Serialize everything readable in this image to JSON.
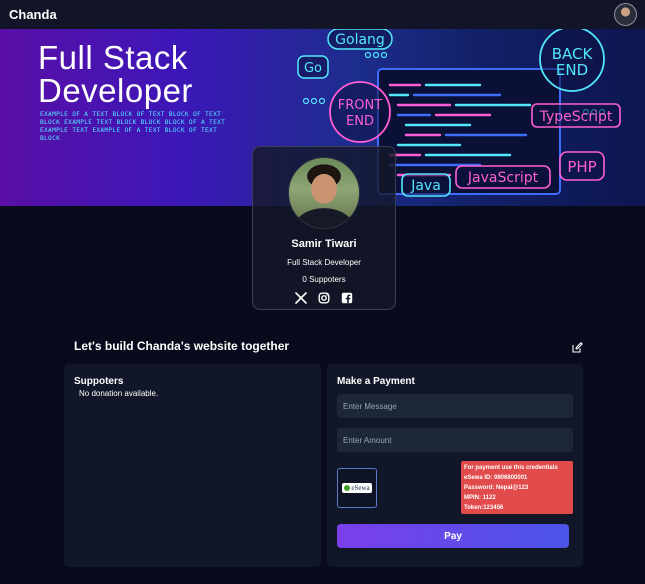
{
  "nav": {
    "brand": "Chanda"
  },
  "banner": {
    "title": "Full Stack\nDeveloper",
    "blurb": "EXAMPLE OF A TEXT BLOCK OF TEXT BLOCK OF TEXT BLOCK EXAMPLE TEXT BLOCK BLOCK BLOCK OF A TEXT EXAMPLE TEXT EXAMPLE OF A TEXT BLOCK OF TEXT BLOCK",
    "tags": {
      "golang": "Golang",
      "go": "Go",
      "front_end_1": "FRONT",
      "front_end_2": "END",
      "back_end_1": "BACK",
      "back_end_2": "END",
      "typescript": "TypeScript",
      "php": "PHP",
      "java": "Java",
      "javascript": "JavaScript"
    }
  },
  "profile": {
    "name": "Samir Tiwari",
    "role": "Full Stack Developer",
    "supporters_count": "0 Suppoters"
  },
  "section": {
    "title": "Let's build Chanda's website together"
  },
  "supporters": {
    "title": "Suppoters",
    "empty_message": "No donation available."
  },
  "payment": {
    "title": "Make a Payment",
    "message_placeholder": "Enter Message",
    "amount_placeholder": "Enter Amount",
    "esewa_label": "eSewa",
    "credentials": {
      "heading": "For payment use this credentials",
      "esewa_id": "eSewa ID: 9806800001",
      "password": "Password: Nepal@123",
      "mpin": "MPIN: 1122",
      "token": "Token:123456"
    },
    "pay_label": "Pay"
  },
  "colors": {
    "page_bg": "#070b1c",
    "panel_bg": "#111728",
    "accent_start": "#7b3fea",
    "accent_end": "#4b55e8",
    "credentials_bg": "#e24b4b",
    "banner_cyan": "#53e7ff",
    "banner_pink": "#ff5fd2"
  }
}
